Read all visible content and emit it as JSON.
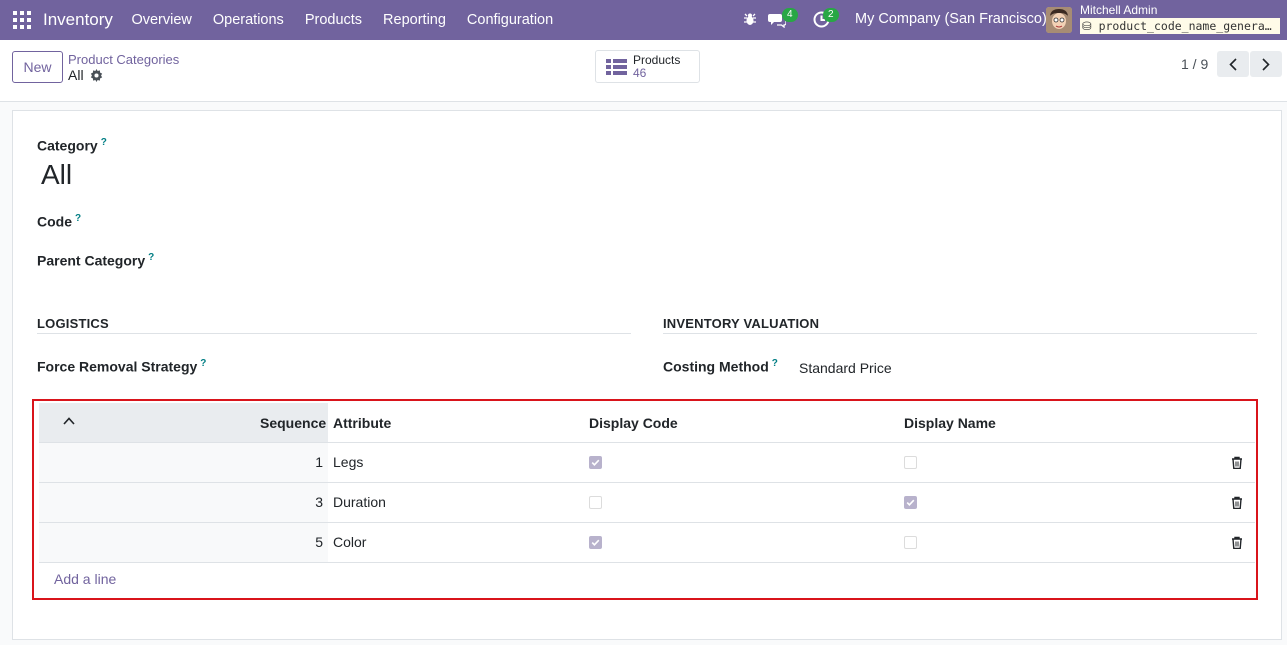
{
  "navbar": {
    "app_name": "Inventory",
    "menu": [
      "Overview",
      "Operations",
      "Products",
      "Reporting",
      "Configuration"
    ],
    "messages_count": "4",
    "activities_count": "2",
    "company": "My Company (San Francisco)",
    "user_name": "Mitchell Admin",
    "database": "product_code_name_genera…"
  },
  "control_panel": {
    "new_label": "New",
    "breadcrumb": "Product Categories",
    "record_name": "All",
    "stat_label": "Products",
    "stat_value": "46",
    "pager_value": "1 / 9"
  },
  "form": {
    "category_label": "Category",
    "category_value": "All",
    "code_label": "Code",
    "parent_label": "Parent Category",
    "logistics_title": "LOGISTICS",
    "removal_label": "Force Removal Strategy",
    "valuation_title": "INVENTORY VALUATION",
    "costing_label": "Costing Method",
    "costing_value": "Standard Price",
    "help_mark": "?"
  },
  "table": {
    "headers": {
      "sequence": "Sequence",
      "attribute": "Attribute",
      "display_code": "Display Code",
      "display_name": "Display Name"
    },
    "rows": [
      {
        "sequence": "1",
        "attribute": "Legs",
        "display_code": true,
        "display_name": false
      },
      {
        "sequence": "3",
        "attribute": "Duration",
        "display_code": false,
        "display_name": true
      },
      {
        "sequence": "5",
        "attribute": "Color",
        "display_code": true,
        "display_name": false
      }
    ],
    "add_line": "Add a line"
  },
  "colors": {
    "brand": "#71639e",
    "highlight_border": "#d9141b",
    "badge": "#28a745",
    "help": "#017e84"
  }
}
